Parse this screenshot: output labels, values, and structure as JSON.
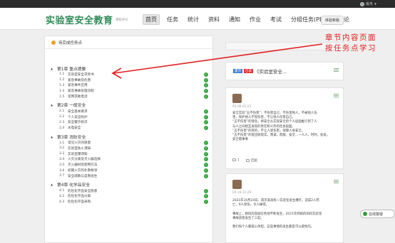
{
  "topbar": {
    "username": "肖杰"
  },
  "header": {
    "logo": "实验室安全教育",
    "logo_sub": "课程评价",
    "nav": [
      "首页",
      "任务",
      "统计",
      "资料",
      "通知",
      "作业",
      "考试",
      "分组任务(PBL)",
      "讨论"
    ],
    "exp_button": "体验新版"
  },
  "tasks": {
    "title": "待完成任务点",
    "chapters": [
      {
        "label": "第1章 重点提要",
        "sections": [
          {
            "num": "1.1",
            "label": "实验室安全求奖书"
          },
          {
            "num": "1.2",
            "label": "紧急事故及危害"
          },
          {
            "num": "1.3",
            "label": "紧急事件应用"
          },
          {
            "num": "1.4",
            "label": "紧急事故处理流程"
          },
          {
            "num": "1.5",
            "label": "常用求助电话"
          }
        ]
      },
      {
        "label": "第2章 一般安全",
        "sections": [
          {
            "num": "2.1",
            "label": "安全基本要求"
          },
          {
            "num": "2.2",
            "label": "个人安全防护"
          },
          {
            "num": "2.3",
            "label": "安全警示标识"
          },
          {
            "num": "2.4",
            "label": "水电安全"
          }
        ]
      },
      {
        "label": "第3章 消防安全",
        "sections": [
          {
            "num": "3.1",
            "label": "常见火灾的隐患"
          },
          {
            "num": "3.2",
            "label": "实验室防火须知"
          },
          {
            "num": "3.3",
            "label": "实验室爆须知"
          },
          {
            "num": "3.4",
            "label": "火灾分类及灭火器选择"
          },
          {
            "num": "3.5",
            "label": "灭火器材及使用方法"
          },
          {
            "num": "3.6",
            "label": "初期火灾的扑救要领"
          },
          {
            "num": "3.7",
            "label": "安全疏散与自救逃生"
          }
        ]
      },
      {
        "label": "第4章 化学品安全",
        "sections": [
          {
            "num": "4.1",
            "label": "危险化学品安全隐患"
          },
          {
            "num": "4.2",
            "label": "危险化学品分类"
          },
          {
            "num": "4.3",
            "label": "危险化学品采购"
          }
        ]
      }
    ]
  },
  "side": {
    "card1": {
      "tag1": "置顶",
      "tag2": "已读",
      "title": "《实验室安全..."
    },
    "post1": {
      "date": "05-08 05:22",
      "lines": [
        "安全实验“五不伤害”：不伤害自己，不伤害他人，不被他人伤",
        "害，保护他人不受伤害，不让他人伤害自己。",
        "“五不伤害”的理念，将安全从实现安全的个人层面推行到了人",
        "与人之间相互发现的责任和义务的社会层面。",
        "“五不伤害”的目的，不让人受伤害，保障人身安全。",
        "“五不伤害”的提出呢现实，而诚，而服，安全…一人人，时时，处处。",
        "安全需事事"
      ],
      "like": "1",
      "reply": "回复"
    },
    "post2": {
      "date": "05-18 22:29",
      "lines": [
        "2021年10月24日，南京某高校一实验室发生爆炸，造成2人死",
        "亡，9人受伤，令人痛惜。",
        "",
        "事故上，相同的悲剧在各地不断发生，2021年例如的高校实验室",
        "事故恶性发生了三起。",
        "",
        "我们每个人都提心吊胆，这些事情的发生都是可以避免的。"
      ]
    }
  },
  "online_button": "在线答疑",
  "annotation": [
    "章节内容页面",
    "按任务点学习"
  ],
  "colors": {
    "accent": "#2e8b57",
    "check": "#2ea83a",
    "annotation": "#e02020"
  }
}
